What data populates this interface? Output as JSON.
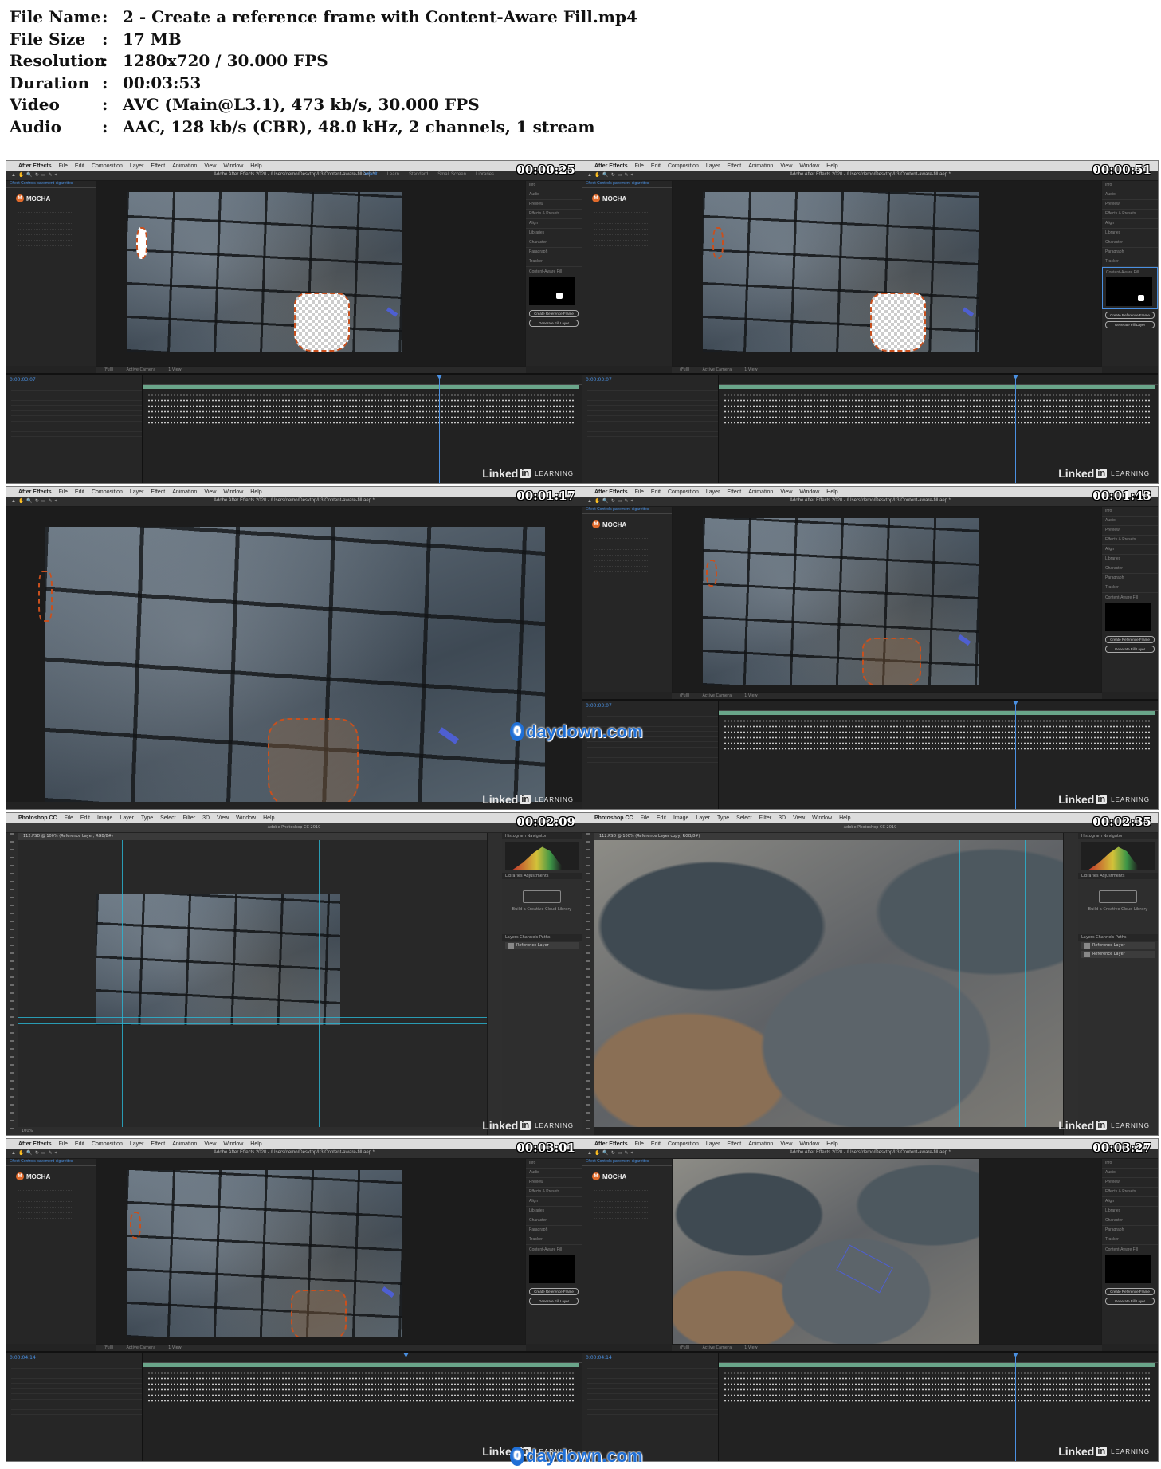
{
  "file_info": {
    "rows": [
      {
        "key": "File Name",
        "value": "2 - Create a reference frame with Content-Aware Fill.mp4"
      },
      {
        "key": "File Size",
        "value": "17 MB"
      },
      {
        "key": "Resolution",
        "value": "1280x720 / 30.000 FPS"
      },
      {
        "key": "Duration",
        "value": "00:03:53"
      },
      {
        "key": "Video",
        "value": "AVC (Main@L3.1), 473 kb/s, 30.000 FPS"
      },
      {
        "key": "Audio",
        "value": "AAC, 128 kb/s (CBR), 48.0 kHz, 2 channels, 1 stream"
      }
    ],
    "separator": ":"
  },
  "thumbnails": [
    {
      "timestamp": "00:00:25",
      "app": "After Effects"
    },
    {
      "timestamp": "00:00:51",
      "app": "After Effects"
    },
    {
      "timestamp": "00:01:17",
      "app": "After Effects"
    },
    {
      "timestamp": "00:01:43",
      "app": "After Effects"
    },
    {
      "timestamp": "00:02:09",
      "app": "Photoshop CC"
    },
    {
      "timestamp": "00:02:35",
      "app": "Photoshop CC"
    },
    {
      "timestamp": "00:03:01",
      "app": "After Effects"
    },
    {
      "timestamp": "00:03:27",
      "app": "After Effects"
    }
  ],
  "ae": {
    "menu": [
      "After Effects",
      "File",
      "Edit",
      "Composition",
      "Layer",
      "Effect",
      "Animation",
      "View",
      "Window",
      "Help"
    ],
    "window_title": "Adobe After Effects 2020 - /Users/demo/Desktop/L3/Content-aware-fill.aep *",
    "workspaces": [
      "Default",
      "Learn",
      "Standard",
      "Small Screen",
      "Libraries"
    ],
    "left_tab": "Effect Controls pavement-cigarettes",
    "mocha_label": "MOCHA",
    "right_items": [
      "Info",
      "Audio",
      "Preview",
      "Effects & Presets",
      "Align",
      "Libraries",
      "Character",
      "Paragraph",
      "Tracker"
    ],
    "caf_title": "Content-Aware Fill",
    "caf_buttons": [
      "Create Reference Frame",
      "Generate Fill Layer"
    ],
    "viewer_bar": [
      "(Full)",
      "Active Camera",
      "1 View"
    ],
    "timecodes": [
      "0:00:03:07",
      "0:00:03:07",
      "0:00:04:14",
      "0:00:04:14"
    ]
  },
  "ps": {
    "menu": [
      "Photoshop CC",
      "File",
      "Edit",
      "Image",
      "Layer",
      "Type",
      "Select",
      "Filter",
      "3D",
      "View",
      "Window",
      "Help"
    ],
    "window_title": "Adobe Photoshop CC 2019",
    "doc_tab_1": "112.PSD @ 100% (Reference Layer, RGB/8#)",
    "doc_tab_2": "112.PSD @ 100% (Reference Layer copy, RGB/8#)",
    "panel_tabs": [
      "Histogram",
      "Navigator"
    ],
    "lib_tabs": [
      "Libraries",
      "Adjustments"
    ],
    "lib_text": "Build a Creative Cloud Library",
    "layers_tabs": [
      "Layers",
      "Channels",
      "Paths"
    ],
    "layer_name": "Reference Layer",
    "status": "100%"
  },
  "watermark": {
    "brand": "Linked",
    "in": "in",
    "learning": "LEARNING"
  },
  "site_watermark": {
    "zero": "0",
    "text": "daydown.com"
  }
}
